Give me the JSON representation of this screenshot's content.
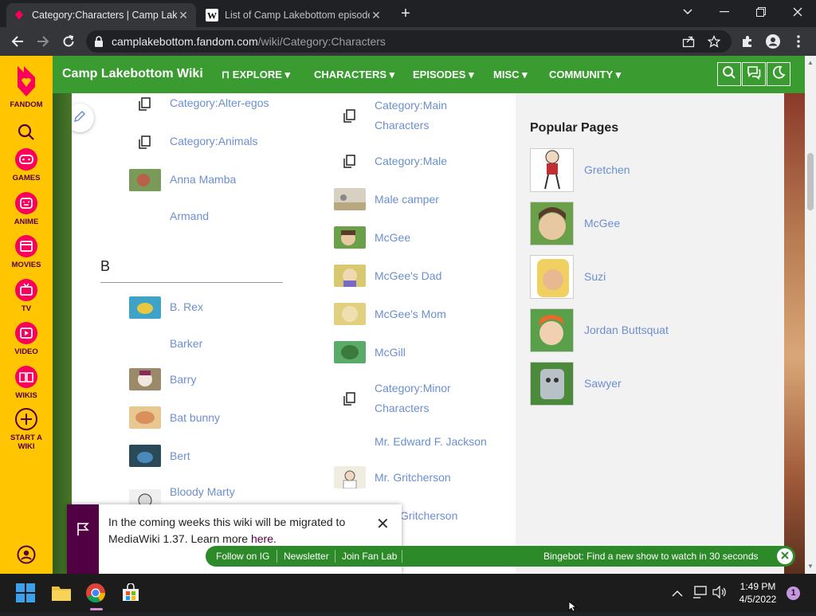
{
  "browser": {
    "tabs": [
      {
        "title": "Category:Characters | Camp Lake",
        "active": true,
        "icon": "fandom-favicon"
      },
      {
        "title": "List of Camp Lakebottom episode",
        "active": false,
        "icon": "wikipedia-favicon"
      }
    ],
    "new_tab_label": "+",
    "url_host": "camplakebottom.fandom.com",
    "url_path": "/wiki/Category:Characters"
  },
  "rail": {
    "brand": "FANDOM",
    "items": [
      {
        "label": "GAMES",
        "icon": "gamepad-icon"
      },
      {
        "label": "ANIME",
        "icon": "anime-face-icon"
      },
      {
        "label": "MOVIES",
        "icon": "clapperboard-icon"
      },
      {
        "label": "TV",
        "icon": "tv-icon"
      },
      {
        "label": "VIDEO",
        "icon": "play-icon"
      },
      {
        "label": "WIKIS",
        "icon": "book-icon"
      }
    ],
    "start_wiki_line1": "START A",
    "start_wiki_line2": "WIKI"
  },
  "wiki": {
    "title": "Camp Lakebottom Wiki",
    "nav": [
      "EXPLORE",
      "CHARACTERS",
      "EPISODES",
      "MISC",
      "COMMUNITY"
    ]
  },
  "categories": {
    "col1_top": [
      {
        "label": "Category:Alter-egos",
        "kind": "category"
      },
      {
        "label": "Category:Animals",
        "kind": "category"
      },
      {
        "label": "Anna Mamba",
        "kind": "thumb",
        "color": "#b8604a"
      },
      {
        "label": "Armand",
        "kind": "none"
      }
    ],
    "section_letter": "B",
    "col1_b": [
      {
        "label": "B. Rex",
        "kind": "thumb",
        "color": "#3fa3c8"
      },
      {
        "label": "Barker",
        "kind": "none"
      },
      {
        "label": "Barry",
        "kind": "thumb",
        "color": "#9a7a5a"
      },
      {
        "label": "Bat bunny",
        "kind": "thumb",
        "color": "#d9a05a"
      },
      {
        "label": "Bert",
        "kind": "thumb",
        "color": "#3a6a8a"
      },
      {
        "label": "Bloody Marty",
        "kind": "thumb",
        "color": "#ddd"
      }
    ],
    "col2": [
      {
        "label": "Category:Main Characters",
        "kind": "category"
      },
      {
        "label": "Category:Male",
        "kind": "category"
      },
      {
        "label": "Male camper",
        "kind": "thumb",
        "color": "#c8b898"
      },
      {
        "label": "McGee",
        "kind": "thumb",
        "color": "#6aa04a"
      },
      {
        "label": "McGee's Dad",
        "kind": "thumb",
        "color": "#c8b050"
      },
      {
        "label": "McGee's Mom",
        "kind": "thumb",
        "color": "#d8c070"
      },
      {
        "label": "McGill",
        "kind": "thumb",
        "color": "#3a8a4a"
      },
      {
        "label": "Category:Minor Characters",
        "kind": "category"
      },
      {
        "label": "Mr. Edward F. Jackson",
        "kind": "none"
      },
      {
        "label": "Mr. Gritcherson",
        "kind": "thumb",
        "color": "#e8e0d0"
      },
      {
        "label": "Gritcherson",
        "kind": "none"
      }
    ]
  },
  "popular": {
    "heading": "Popular Pages",
    "items": [
      {
        "label": "Gretchen",
        "color": "#e8e8e8"
      },
      {
        "label": "McGee",
        "color": "#6aa04a"
      },
      {
        "label": "Suzi",
        "color": "#e8d080"
      },
      {
        "label": "Jordan Buttsquat",
        "color": "#5aa04a"
      },
      {
        "label": "Sawyer",
        "color": "#4a8a3a"
      }
    ]
  },
  "notification": {
    "text_before": "In the coming weeks this wiki will be migrated to MediaWiki 1.37. Learn more ",
    "link": "here",
    "text_after": "."
  },
  "greenbar": {
    "items": [
      "Follow on IG",
      "Newsletter",
      "Join Fan Lab"
    ],
    "bingebot": "Bingebot: Find a new show to watch in 30 seconds"
  },
  "taskbar": {
    "time": "1:49 PM",
    "date": "4/5/2022",
    "badge": "1"
  }
}
